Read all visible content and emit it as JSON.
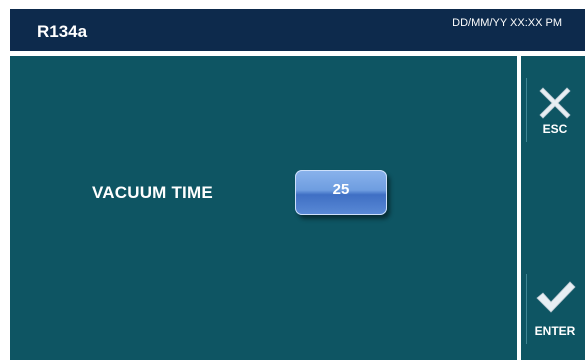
{
  "header": {
    "title": "R134a",
    "datetime": "DD/MM/YY XX:XX PM"
  },
  "main": {
    "label": "VACUUM TIME",
    "value": "25"
  },
  "sidebar": {
    "esc_label": "ESC",
    "enter_label": "ENTER"
  },
  "colors": {
    "header_bg": "#0d2a4c",
    "panel_bg": "#0e5563",
    "value_button": "#6e9de0"
  },
  "icons": {
    "esc": "close-x-icon",
    "enter": "check-mark-icon"
  }
}
